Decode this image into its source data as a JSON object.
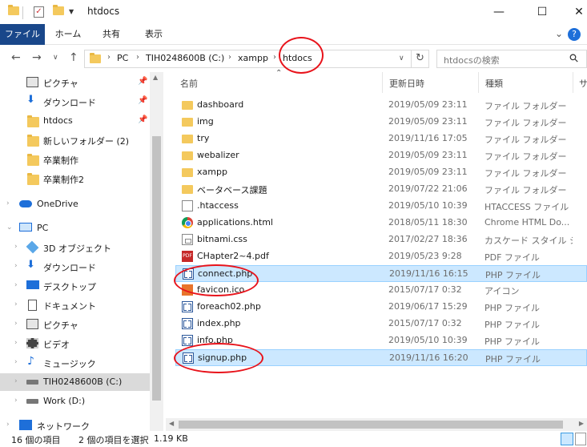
{
  "window": {
    "title": "htdocs",
    "minimize_icon": "—",
    "maximize_icon": "☐",
    "close_icon": "✕"
  },
  "ribbon": {
    "tabs": [
      "ファイル",
      "ホーム",
      "共有",
      "表示"
    ]
  },
  "address": {
    "crumbs": [
      "PC",
      "TIH0248600B (C:)",
      "xampp",
      "htdocs"
    ]
  },
  "search": {
    "placeholder": "htdocsの検索"
  },
  "sidebar": {
    "items": [
      {
        "label": "ピクチャ",
        "icon": "pictures-icon",
        "pinned": true
      },
      {
        "label": "ダウンロード",
        "icon": "download-icon",
        "pinned": true
      },
      {
        "label": "htdocs",
        "icon": "folder-icon",
        "pinned": true
      },
      {
        "label": "新しいフォルダー (2)",
        "icon": "folder-icon",
        "pinned": false
      },
      {
        "label": "卒業制作",
        "icon": "folder-icon",
        "pinned": false
      },
      {
        "label": "卒業制作2",
        "icon": "folder-icon",
        "pinned": false
      },
      {
        "label": "OneDrive",
        "icon": "cloud-icon",
        "pinned": false
      },
      {
        "label": "PC",
        "icon": "computer-icon",
        "pinned": false
      },
      {
        "label": "3D オブジェクト",
        "icon": "cube-icon",
        "pinned": false
      },
      {
        "label": "ダウンロード",
        "icon": "download-icon",
        "pinned": false
      },
      {
        "label": "デスクトップ",
        "icon": "desktop-icon",
        "pinned": false
      },
      {
        "label": "ドキュメント",
        "icon": "document-icon",
        "pinned": false
      },
      {
        "label": "ピクチャ",
        "icon": "pictures-icon",
        "pinned": false
      },
      {
        "label": "ビデオ",
        "icon": "video-icon",
        "pinned": false
      },
      {
        "label": "ミュージック",
        "icon": "music-icon",
        "pinned": false
      },
      {
        "label": "TIH0248600B (C:)",
        "icon": "drive-icon",
        "pinned": false
      },
      {
        "label": "Work (D:)",
        "icon": "drive-icon",
        "pinned": false
      },
      {
        "label": "ネットワーク",
        "icon": "network-icon",
        "pinned": false
      }
    ]
  },
  "columns": {
    "name": "名前",
    "date": "更新日時",
    "type": "種類",
    "size": "サ"
  },
  "files": [
    {
      "name": "dashboard",
      "date": "2019/05/09 23:11",
      "type": "ファイル フォルダー",
      "icon": "folder"
    },
    {
      "name": "img",
      "date": "2019/05/09 23:11",
      "type": "ファイル フォルダー",
      "icon": "folder"
    },
    {
      "name": "try",
      "date": "2019/11/16 17:05",
      "type": "ファイル フォルダー",
      "icon": "folder"
    },
    {
      "name": "webalizer",
      "date": "2019/05/09 23:11",
      "type": "ファイル フォルダー",
      "icon": "folder"
    },
    {
      "name": "xampp",
      "date": "2019/05/09 23:11",
      "type": "ファイル フォルダー",
      "icon": "folder"
    },
    {
      "name": "ベータベース課題",
      "date": "2019/07/22 21:06",
      "type": "ファイル フォルダー",
      "icon": "folder"
    },
    {
      "name": ".htaccess",
      "date": "2019/05/10 10:39",
      "type": "HTACCESS ファイル",
      "icon": "doc"
    },
    {
      "name": "applications.html",
      "date": "2018/05/11 18:30",
      "type": "Chrome HTML Do...",
      "icon": "chrome"
    },
    {
      "name": "bitnami.css",
      "date": "2017/02/27 18:36",
      "type": "カスケード スタイル シ...",
      "icon": "css"
    },
    {
      "name": "CHapter2~4.pdf",
      "date": "2019/05/23 9:28",
      "type": "PDF ファイル",
      "icon": "pdf"
    },
    {
      "name": "connect.php",
      "date": "2019/11/16 16:15",
      "type": "PHP ファイル",
      "icon": "php",
      "selected": true
    },
    {
      "name": "favicon.ico",
      "date": "2015/07/17 0:32",
      "type": "アイコン",
      "icon": "fav"
    },
    {
      "name": "foreach02.php",
      "date": "2019/06/17 15:29",
      "type": "PHP ファイル",
      "icon": "php"
    },
    {
      "name": "index.php",
      "date": "2015/07/17 0:32",
      "type": "PHP ファイル",
      "icon": "php"
    },
    {
      "name": "info.php",
      "date": "2019/05/10 10:39",
      "type": "PHP ファイル",
      "icon": "php"
    },
    {
      "name": "signup.php",
      "date": "2019/11/16 16:20",
      "type": "PHP ファイル",
      "icon": "php",
      "selected": true
    }
  ],
  "status": {
    "count": "16 個の項目",
    "selection": "2 個の項目を選択",
    "size": "1.19 KB"
  },
  "colors": {
    "file_tab": "#19478a",
    "selection_bg": "#cce8ff",
    "annotation": "#e8131b",
    "folder": "#f4c95d"
  }
}
